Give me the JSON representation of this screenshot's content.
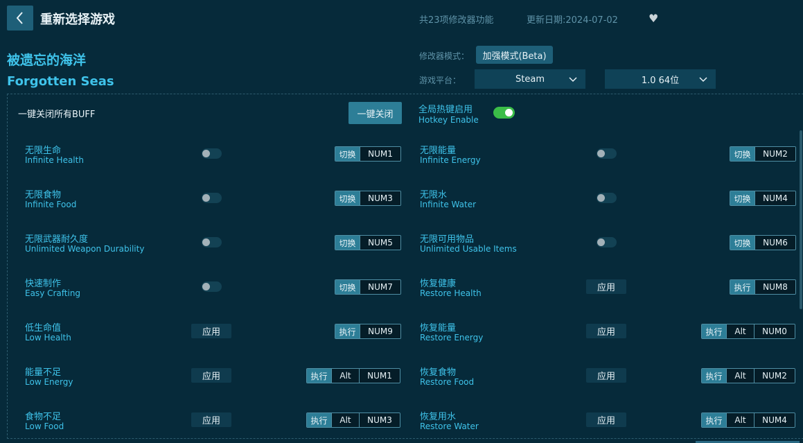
{
  "header": {
    "title": "重新选择游戏",
    "feature_count": "共23项修改器功能",
    "update_date": "更新日期:2024-07-02"
  },
  "game": {
    "name_cn": "被遗忘的海洋",
    "name_en": "Forgotten Seas"
  },
  "options": {
    "mode_label": "修改器模式：",
    "mode_value": "加强模式(Beta)",
    "platform_label": "游戏平台：",
    "platform_value": "Steam",
    "version_value": "1.0 64位"
  },
  "panel": {
    "buff_label": "一键关闭所有BUFF",
    "close_all_button": "一键关闭",
    "hotkey_cn": "全局热键启用",
    "hotkey_en": "Hotkey Enable",
    "hotkey_enabled": true
  },
  "features": [
    {
      "cn": "无限生命",
      "en": "Infinite Health",
      "control": "toggle",
      "action": "切换",
      "keys": [
        "NUM1"
      ]
    },
    {
      "cn": "无限能量",
      "en": "Infinite Energy",
      "control": "toggle",
      "action": "切换",
      "keys": [
        "NUM2"
      ]
    },
    {
      "cn": "无限食物",
      "en": "Infinite Food",
      "control": "toggle",
      "action": "切换",
      "keys": [
        "NUM3"
      ]
    },
    {
      "cn": "无限水",
      "en": "Infinite Water",
      "control": "toggle",
      "action": "切换",
      "keys": [
        "NUM4"
      ]
    },
    {
      "cn": "无限武器耐久度",
      "en": "Unlimited Weapon Durability",
      "control": "toggle",
      "action": "切换",
      "keys": [
        "NUM5"
      ]
    },
    {
      "cn": "无限可用物品",
      "en": "Unlimited Usable Items",
      "control": "toggle",
      "action": "切换",
      "keys": [
        "NUM6"
      ]
    },
    {
      "cn": "快速制作",
      "en": "Easy Crafting",
      "control": "toggle",
      "action": "切换",
      "keys": [
        "NUM7"
      ]
    },
    {
      "cn": "恢复健康",
      "en": "Restore Health",
      "control": "apply",
      "control_label": "应用",
      "action": "执行",
      "keys": [
        "NUM8"
      ]
    },
    {
      "cn": "低生命值",
      "en": "Low Health",
      "control": "apply",
      "control_label": "应用",
      "action": "执行",
      "keys": [
        "NUM9"
      ]
    },
    {
      "cn": "恢复能量",
      "en": "Restore Energy",
      "control": "apply",
      "control_label": "应用",
      "action": "执行",
      "keys": [
        "Alt",
        "NUM0"
      ]
    },
    {
      "cn": "能量不足",
      "en": "Low Energy",
      "control": "apply",
      "control_label": "应用",
      "action": "执行",
      "keys": [
        "Alt",
        "NUM1"
      ]
    },
    {
      "cn": "恢复食物",
      "en": "Restore Food",
      "control": "apply",
      "control_label": "应用",
      "action": "执行",
      "keys": [
        "Alt",
        "NUM2"
      ]
    },
    {
      "cn": "食物不足",
      "en": "Low Food",
      "control": "apply",
      "control_label": "应用",
      "action": "执行",
      "keys": [
        "Alt",
        "NUM3"
      ]
    },
    {
      "cn": "恢复用水",
      "en": "Restore Water",
      "control": "apply",
      "control_label": "应用",
      "action": "执行",
      "keys": [
        "Alt",
        "NUM4"
      ]
    }
  ],
  "colors": {
    "background": "#062a3a",
    "accent": "#3fc3ea",
    "button": "#1e5f78",
    "toggle_on": "#3bbd48"
  },
  "icons": {
    "back": "chevron-left-icon",
    "favorite": "heart-icon",
    "dropdown": "chevron-down-icon"
  }
}
